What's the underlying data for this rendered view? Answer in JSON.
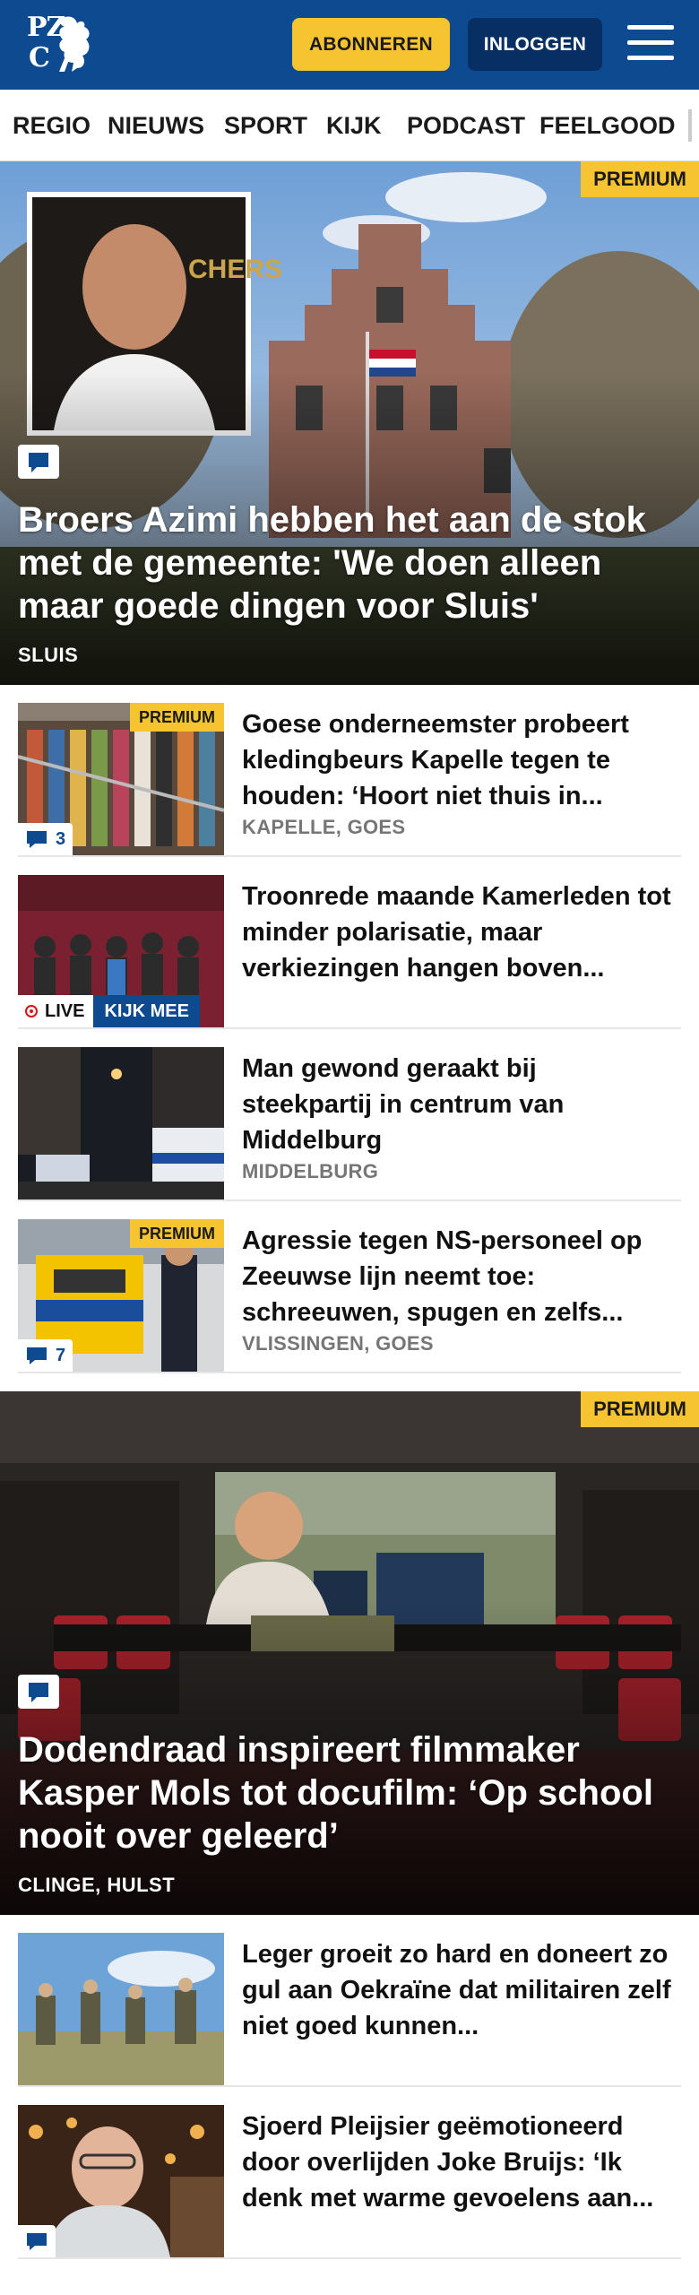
{
  "header": {
    "logo_line1": "PZ",
    "logo_line2": "C",
    "subscribe_label": "ABONNEREN",
    "login_label": "INLOGGEN"
  },
  "nav": {
    "items": [
      "REGIO",
      "NIEUWS",
      "SPORT",
      "KIJK",
      "PODCAST",
      "FEELGOOD"
    ]
  },
  "premium_label": "PREMIUM",
  "hero1": {
    "title": "Broers Azimi hebben het aan de stok met de gemeente: 'We doen alleen maar goede dingen voor Sluis'",
    "location": "SLUIS",
    "premium": true
  },
  "articles1": [
    {
      "headline": "Goese onderneemster probeert kledingbeurs Kapelle tegen te houden: ‘Hoort niet thuis in...",
      "meta": "KAPELLE, GOES",
      "premium": true,
      "comments": "3"
    },
    {
      "headline": "Troonrede maande Kamerleden tot minder polarisatie, maar verkiezingen hangen boven...",
      "meta": "",
      "live_label": "LIVE",
      "watch_label": "KIJK MEE"
    },
    {
      "headline": "Man gewond geraakt bij steekpartij in centrum van Middelburg",
      "meta": "MIDDELBURG"
    },
    {
      "headline": "Agressie tegen NS-personeel op Zeeuwse lijn neemt toe: schreeuwen, spugen en zelfs...",
      "meta": "VLISSINGEN, GOES",
      "premium": true,
      "comments": "7"
    }
  ],
  "hero2": {
    "title": "Dodendraad inspireert filmmaker Kasper Mols tot docufilm: ‘Op school nooit over geleerd’",
    "location": "CLINGE, HULST",
    "premium": true
  },
  "articles2": [
    {
      "headline": "Leger groeit zo hard en doneert zo gul aan Oekraïne dat militairen zelf niet goed kunnen...",
      "meta": ""
    },
    {
      "headline": "Sjoerd Pleijsier geëmotioneerd door overlijden Joke Bruijs: ‘Ik denk met warme gevoelens aan...",
      "meta": ""
    }
  ],
  "colors": {
    "brand": "#0e4a8f",
    "premium": "#f6c431",
    "meta": "#767676"
  }
}
